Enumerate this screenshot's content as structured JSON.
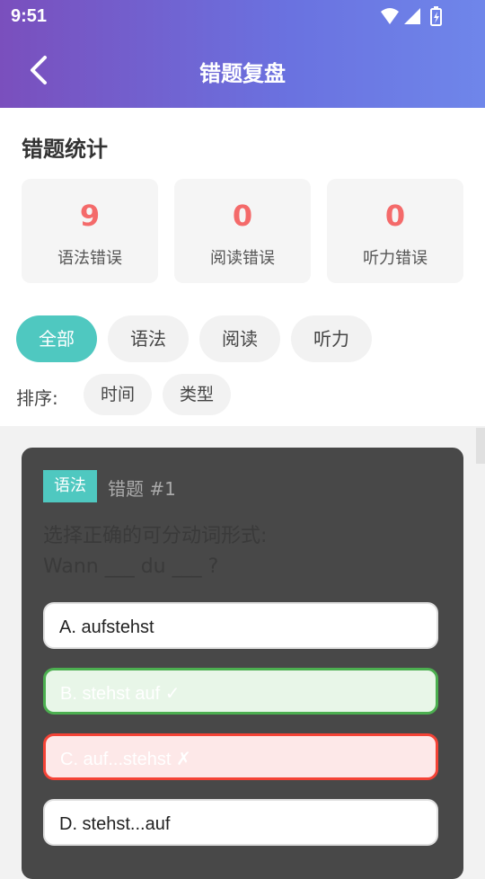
{
  "status_bar": {
    "time": "9:51"
  },
  "header": {
    "title": "错题复盘"
  },
  "stats": {
    "title": "错题统计",
    "items": [
      {
        "value": "9",
        "label": "语法错误"
      },
      {
        "value": "0",
        "label": "阅读错误"
      },
      {
        "value": "0",
        "label": "听力错误"
      }
    ]
  },
  "filters": {
    "tabs": [
      "全部",
      "语法",
      "阅读",
      "听力"
    ],
    "active_index": 0,
    "sort_label": "排序:",
    "sort_options": [
      "时间",
      "类型"
    ]
  },
  "question_card": {
    "tag": "语法",
    "number": "错题 #1",
    "prompt_line1": "选择正确的可分动词形式:",
    "prompt_line2": "Wann ___ du ___ ?",
    "options": [
      {
        "text": "A. aufstehst",
        "state": "normal"
      },
      {
        "text": "B. stehst auf ✓",
        "state": "correct"
      },
      {
        "text": "C. auf...stehst ✗",
        "state": "wrong"
      },
      {
        "text": "D. stehst...auf",
        "state": "normal"
      }
    ]
  },
  "colors": {
    "accent": "#4fc8c0",
    "error_number": "#f46a6a",
    "correct_border": "#4caf50",
    "wrong_border": "#f44336"
  }
}
